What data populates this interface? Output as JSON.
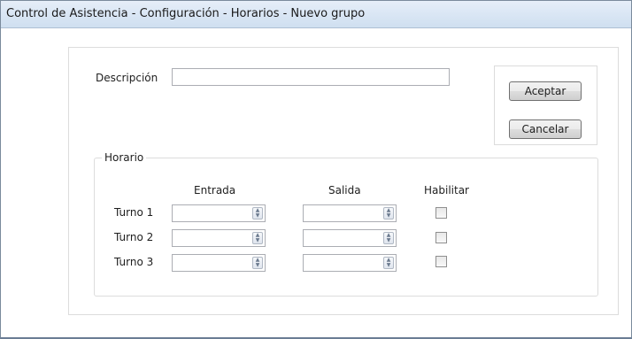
{
  "window": {
    "title": "Control de Asistencia - Configuración - Horarios - Nuevo grupo"
  },
  "form": {
    "description_label": "Descripción",
    "description_value": ""
  },
  "buttons": {
    "accept": "Aceptar",
    "cancel": "Cancelar"
  },
  "schedule": {
    "group_title": "Horario",
    "headers": {
      "entry": "Entrada",
      "exit": "Salida",
      "enable": "Habilitar"
    },
    "shifts": [
      {
        "label": "Turno 1",
        "entry": "",
        "exit": "",
        "enabled": false
      },
      {
        "label": "Turno 2",
        "entry": "",
        "exit": "",
        "enabled": false
      },
      {
        "label": "Turno 3",
        "entry": "",
        "exit": "",
        "enabled": false
      }
    ]
  },
  "icons": {
    "spinner": "up-down-spinner-icon"
  }
}
